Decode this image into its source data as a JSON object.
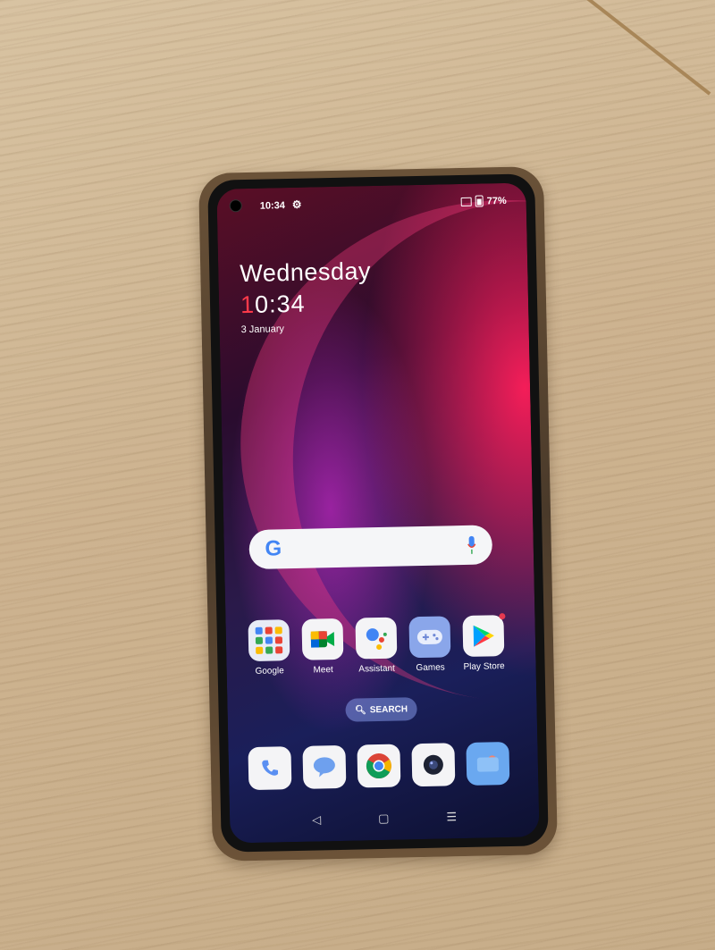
{
  "status_bar": {
    "time": "10:34",
    "battery": "77%"
  },
  "clock_widget": {
    "day": "Wednesday",
    "time_first_digit": "1",
    "time_rest": "0:34",
    "date": "3 January"
  },
  "search_bar": {
    "logo": "G"
  },
  "apps": [
    {
      "label": "Google",
      "icon": "google-folder-icon"
    },
    {
      "label": "Meet",
      "icon": "meet-icon"
    },
    {
      "label": "Assistant",
      "icon": "assistant-icon"
    },
    {
      "label": "Games",
      "icon": "games-icon"
    },
    {
      "label": "Play Store",
      "icon": "play-store-icon"
    }
  ],
  "app_search": {
    "label": "SEARCH"
  },
  "dock": [
    {
      "icon": "phone-icon"
    },
    {
      "icon": "messages-icon"
    },
    {
      "icon": "chrome-icon"
    },
    {
      "icon": "camera-icon"
    },
    {
      "icon": "files-icon"
    }
  ],
  "nav": {
    "back": "◁",
    "home": "▢",
    "recents": "☰"
  },
  "colors": {
    "accent_red": "#ff3a4a",
    "search_pill": "#8296e6",
    "notif_dot": "#e53950"
  }
}
